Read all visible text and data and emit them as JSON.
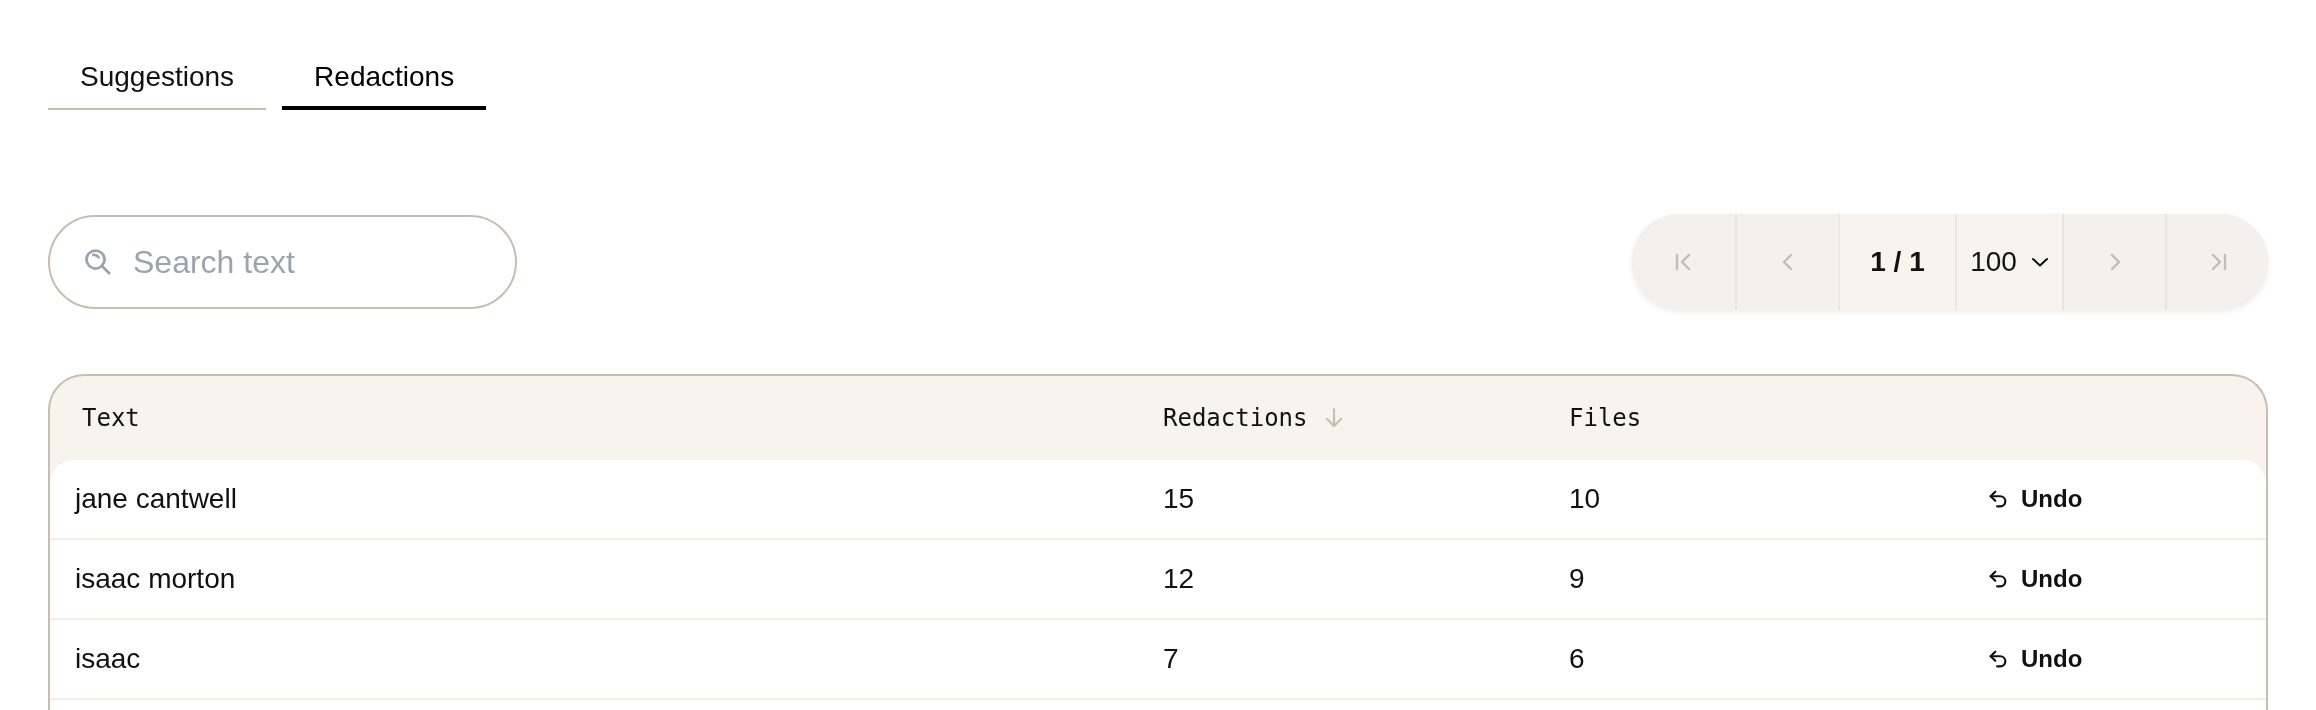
{
  "tabs": [
    {
      "label": "Suggestions",
      "selected": false
    },
    {
      "label": "Redactions",
      "selected": true
    }
  ],
  "search": {
    "placeholder": "Search text"
  },
  "pagination": {
    "items": [
      {
        "kind": "first",
        "disabled": true
      },
      {
        "kind": "previous",
        "disabled": true
      },
      {
        "kind": "page",
        "text": "1 / 1"
      },
      {
        "kind": "page_size",
        "text": "100"
      },
      {
        "kind": "next",
        "disabled": true
      },
      {
        "kind": "last",
        "disabled": true
      }
    ]
  },
  "table": {
    "columns": [
      {
        "label": "Text",
        "sorted": false
      },
      {
        "label": "Redactions",
        "sorted": true
      },
      {
        "label": "Files",
        "sorted": false
      }
    ],
    "rows": [
      {
        "text": "jane cantwell",
        "redactions": "15",
        "files": "10",
        "action": "Undo"
      },
      {
        "text": "isaac morton",
        "redactions": "12",
        "files": "9",
        "action": "Undo"
      },
      {
        "text": "isaac",
        "redactions": "7",
        "files": "6",
        "action": "Undo"
      }
    ]
  }
}
